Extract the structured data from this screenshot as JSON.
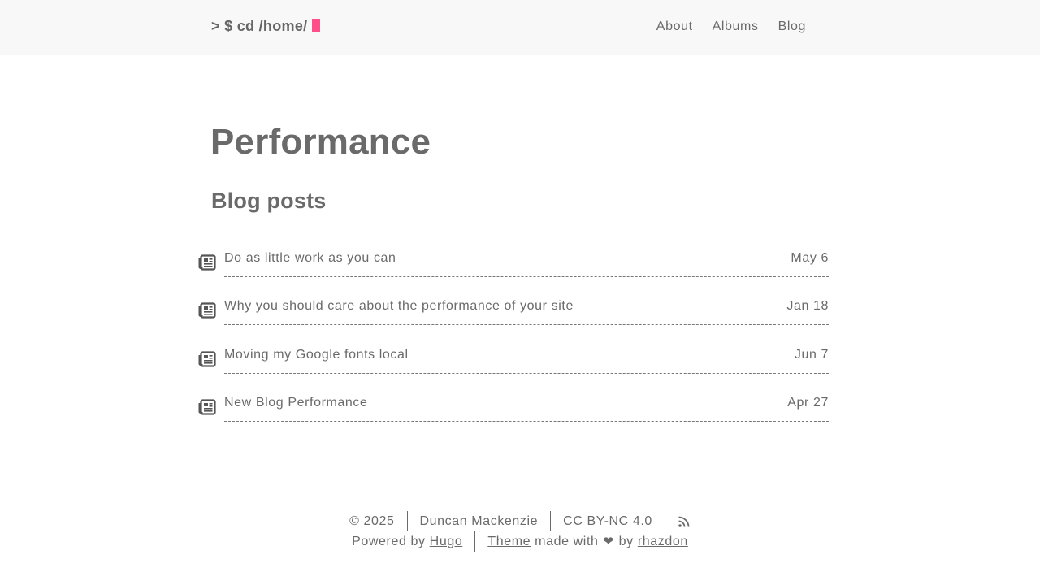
{
  "header": {
    "logo_prefix": "> $ cd /home/",
    "cursor_color": "#ff4f8a",
    "nav": [
      {
        "label": "About"
      },
      {
        "label": "Albums"
      },
      {
        "label": "Blog"
      }
    ]
  },
  "main": {
    "title": "Performance",
    "section_title": "Blog posts",
    "post_icon": "newspaper-icon",
    "posts": [
      {
        "title": "Do as little work as you can",
        "date": "May 6"
      },
      {
        "title": "Why you should care about the performance of your site",
        "date": "Jan 18"
      },
      {
        "title": "Moving my Google fonts local",
        "date": "Jun 7"
      },
      {
        "title": "New Blog Performance",
        "date": "Apr 27"
      }
    ]
  },
  "footer": {
    "copyright": "© 2025",
    "author_link": "Duncan Mackenzie",
    "license_link": "CC BY-NC 4.0",
    "rss_icon": "rss-icon",
    "powered_by_text": "Powered by",
    "hugo_link": "Hugo",
    "theme_link": "Theme",
    "made_with_text": "made with",
    "heart_icon": "heart-icon",
    "by_text": "by",
    "rhazdon_link": "rhazdon"
  }
}
